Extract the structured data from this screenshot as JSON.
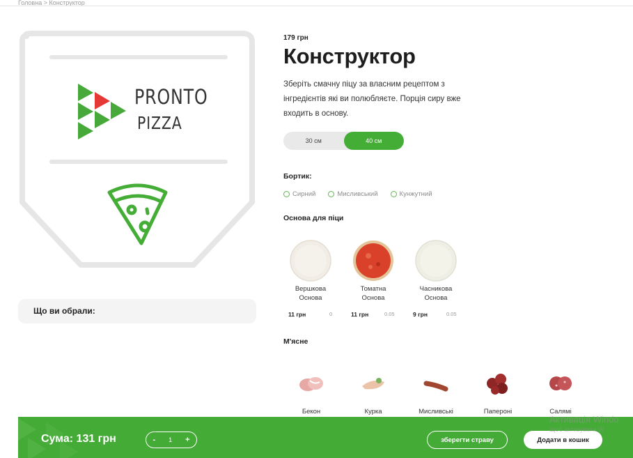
{
  "breadcrumb": "Головна > Конструктор",
  "logo": {
    "line1": "PRONTO",
    "line2": "PIZZA"
  },
  "chosen_label": "Що ви обрали:",
  "product": {
    "price": "179 грн",
    "title": "Конструктор",
    "description": "Зберіть смачну піцу за власним рецептом з інгредієнтів які ви полюбляєте. Порція сиру вже входить в основу."
  },
  "sizes": [
    {
      "label": "30 см",
      "active": false
    },
    {
      "label": "40 см",
      "active": true
    }
  ],
  "crust": {
    "label": "Бортик:",
    "options": [
      "Сирний",
      "Мисливський",
      "Кунжутний"
    ]
  },
  "bases": {
    "label": "Основа для піци",
    "items": [
      {
        "name": "Вершкова Основа",
        "price": "11 грн",
        "weight": "0",
        "color": "#f1ede6"
      },
      {
        "name": "Томатна Основа",
        "price": "11 грн",
        "weight": "0.05",
        "color": "#d9412b"
      },
      {
        "name": "Часникова Основа",
        "price": "9 грн",
        "weight": "0.05",
        "color": "#eeeee4"
      }
    ]
  },
  "meat": {
    "label": "М'ясне",
    "items": [
      {
        "name": "Бекон",
        "color": "#e5a8a6"
      },
      {
        "name": "Курка",
        "color": "#ebc3a9"
      },
      {
        "name": "Мисливські",
        "color": "#a14730"
      },
      {
        "name": "Папероні",
        "color": "#8e2626"
      },
      {
        "name": "Салямі",
        "color": "#b5474a"
      }
    ]
  },
  "bottom_bar": {
    "sum": "Сума: 131 грн",
    "qty_minus": "-",
    "qty_value": "1",
    "qty_plus": "+",
    "save": "зберегти страву",
    "add_to_cart": "Додати в кошик"
  },
  "watermark": {
    "line1": "Активація Windo",
    "line2": "Щоб активувати W"
  },
  "colors": {
    "accent": "#45ab37",
    "logo_red": "#e53935",
    "frame": "#e6e6e6"
  }
}
